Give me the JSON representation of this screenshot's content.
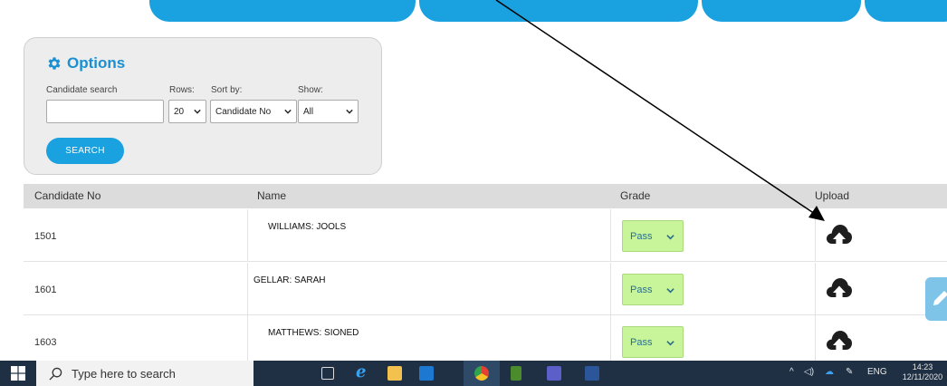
{
  "options": {
    "title": "Options",
    "labels": {
      "candidate_search": "Candidate search",
      "rows": "Rows:",
      "sort_by": "Sort by:",
      "show": "Show:"
    },
    "candidate_search_value": "",
    "rows_value": "20",
    "sort_by_value": "Candidate No",
    "show_value": "All",
    "search_button": "SEARCH"
  },
  "table": {
    "headers": [
      "Candidate No",
      "Name",
      "Grade",
      "Upload"
    ],
    "rows": [
      {
        "candidate_no": "1501",
        "name": "WILLIAMS: JOOLS",
        "grade": "Pass"
      },
      {
        "candidate_no": "1601",
        "name": "GELLAR: SARAH",
        "grade": "Pass"
      },
      {
        "candidate_no": "1603",
        "name": "MATTHEWS: SIONED",
        "grade": "Pass"
      }
    ]
  },
  "taskbar": {
    "search_placeholder": "Type here to search",
    "language": "ENG",
    "time": "14:23",
    "date": "12/11/2020"
  },
  "colors": {
    "accent": "#1aa1e0",
    "grade_bg": "#c8f59a",
    "taskbar": "#1f3044"
  },
  "icons": [
    "gear-icon",
    "chevron-down-icon",
    "cloud-upload-icon",
    "pencil-icon",
    "windows-icon",
    "search-icon"
  ]
}
